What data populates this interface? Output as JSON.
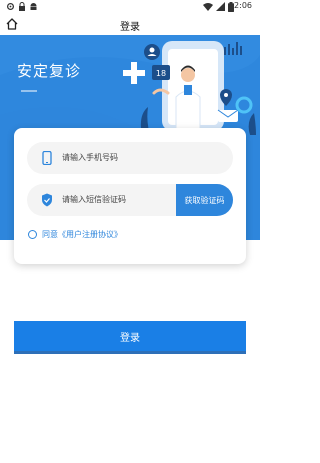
{
  "status_bar": {
    "time": "2:06",
    "icons": [
      "settings-icon",
      "lock-icon",
      "android-icon",
      "wifi-icon",
      "signal-icon",
      "battery-icon"
    ]
  },
  "header": {
    "title": "登录",
    "home_icon": "home-icon"
  },
  "banner": {
    "brand": "安定复诊",
    "illustration_number": "18",
    "accent_color": "#2e86dc"
  },
  "form": {
    "phone_placeholder": "请输入手机号码",
    "code_placeholder": "请输入短信验证码",
    "get_code_label": "获取验证码",
    "agreement_label": "同意《用户注册协议》"
  },
  "login": {
    "label": "登录",
    "color": "#1a7fe6"
  }
}
